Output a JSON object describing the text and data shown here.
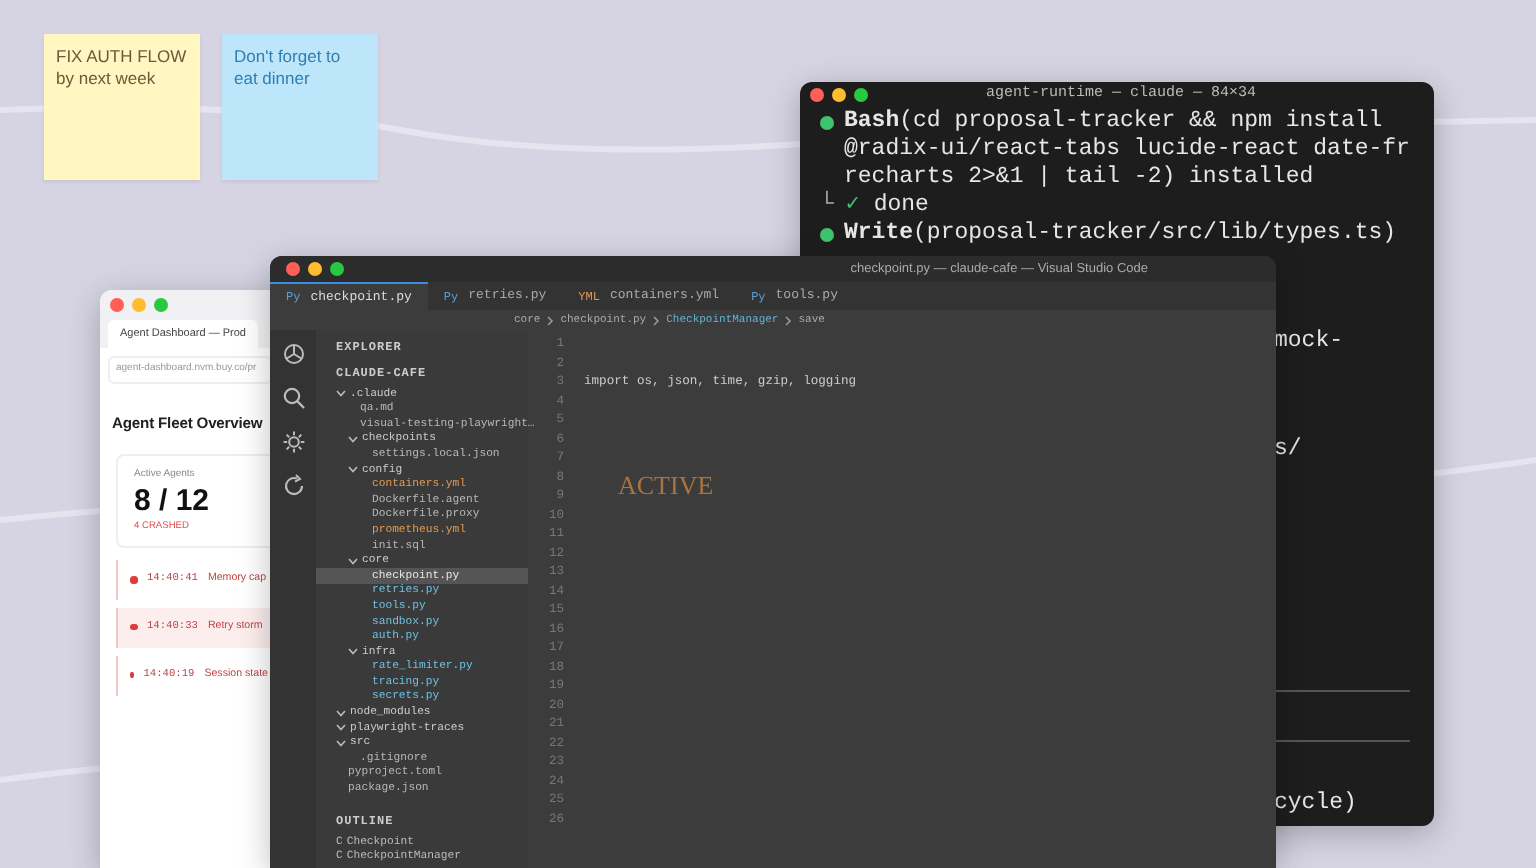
{
  "desktop": {
    "sticky_notes": [
      {
        "text": "FIX AUTH FLOW by next week",
        "color": "#fff6c2"
      },
      {
        "text": "Don't forget to eat dinner",
        "color": "#bde6fb"
      }
    ]
  },
  "browser": {
    "tabs": [
      {
        "label": "Agent Dashboard — Prod",
        "selected": true
      }
    ],
    "url": "agent-dashboard.nvm.buy.co/pr",
    "heading": "Agent Fleet Overview",
    "stat": {
      "label": "Active Agents",
      "value": "8 / 12",
      "note": "4 CRASHED"
    },
    "events": [
      {
        "time": "14:40:41",
        "message": "Memory cap",
        "highlighted": false
      },
      {
        "time": "14:40:33",
        "message": "Retry storm",
        "highlighted": true
      },
      {
        "time": "14:40:19",
        "message": "Session state",
        "highlighted": false
      }
    ]
  },
  "terminal": {
    "title": "agent-runtime — claude — 84×34",
    "lines": [
      {
        "kind": "tool",
        "name": "Bash",
        "args": "(cd proposal-tracker && npm install"
      },
      {
        "kind": "text",
        "text": "@radix-ui/react-tabs lucide-react date-fr"
      },
      {
        "kind": "text",
        "text": "recharts 2>&1 | tail -2) installed"
      },
      {
        "kind": "result",
        "branch": "└",
        "check": "✓",
        "text": "done"
      },
      {
        "kind": "tool",
        "name": "Write",
        "args": "(proposal-tracker/src/lib/types.ts)"
      },
      {
        "kind": "fragment",
        "text": "mock-"
      },
      {
        "kind": "fragment",
        "text": "s/"
      }
    ],
    "footer_fragment": "cycle)"
  },
  "editor": {
    "title": "checkpoint.py — claude-cafe — Visual Studio Code",
    "tabs": [
      {
        "icon": "Py",
        "label": "checkpoint.py",
        "selected": true
      },
      {
        "icon": "Py",
        "label": "retries.py",
        "selected": false
      },
      {
        "icon": "YML",
        "label": "containers.yml",
        "selected": false
      },
      {
        "icon": "Py",
        "label": "tools.py",
        "selected": false
      }
    ],
    "breadcrumb": [
      "core",
      "checkpoint.py",
      "CheckpointManager",
      "save"
    ],
    "sidebar": {
      "title": "EXPLORER",
      "project": "CLAUDE-CAFE",
      "tree": [
        {
          "label": ".claude",
          "expanded": true,
          "selected": false,
          "children": [
            {
              "label": "qa.md",
              "selected": false,
              "color": "#b8b8b8"
            },
            {
              "label": "visual-testing-playwright…",
              "selected": false,
              "color": "#b8b8b8"
            },
            {
              "label": "checkpoints",
              "expanded": true,
              "selected": false,
              "children": [
                {
                  "label": "settings.local.json",
                  "selected": false,
                  "color": "#b8b8b8"
                }
              ]
            },
            {
              "label": "config",
              "expanded": true,
              "selected": false,
              "children": [
                {
                  "label": "containers.yml",
                  "selected": false,
                  "color": "#e39a4f"
                },
                {
                  "label": "Dockerfile.agent",
                  "selected": false,
                  "color": "#b8b8b8"
                },
                {
                  "label": "Dockerfile.proxy",
                  "selected": false,
                  "color": "#b8b8b8"
                },
                {
                  "label": "prometheus.yml",
                  "selected": false,
                  "color": "#e39a4f"
                },
                {
                  "label": "init.sql",
                  "selected": false,
                  "color": "#b8b8b8"
                }
              ]
            },
            {
              "label": "core",
              "expanded": true,
              "selected": false,
              "children": [
                {
                  "label": "checkpoint.py",
                  "selected": true,
                  "color": "#e8e8e8"
                },
                {
                  "label": "retries.py",
                  "selected": false,
                  "color": "#6cc3e0"
                },
                {
                  "label": "tools.py",
                  "selected": false,
                  "color": "#6cc3e0"
                },
                {
                  "label": "sandbox.py",
                  "selected": false,
                  "color": "#6cc3e0"
                },
                {
                  "label": "auth.py",
                  "selected": false,
                  "color": "#6cc3e0"
                }
              ]
            },
            {
              "label": "infra",
              "expanded": true,
              "selected": false,
              "children": [
                {
                  "label": "rate_limiter.py",
                  "selected": false,
                  "color": "#6cc3e0"
                },
                {
                  "label": "tracing.py",
                  "selected": false,
                  "color": "#6cc3e0"
                },
                {
                  "label": "secrets.py",
                  "selected": false,
                  "color": "#6cc3e0"
                }
              ]
            }
          ]
        },
        {
          "label": "node_modules",
          "expanded": true,
          "selected": false
        },
        {
          "label": "playwright-traces",
          "expanded": true,
          "selected": false
        },
        {
          "label": "src",
          "expanded": true,
          "selected": false,
          "children": [
            {
              "label": ".gitignore",
              "selected": false,
              "color": "#b8b8b8"
            }
          ]
        },
        {
          "label": "pyproject.toml",
          "selected": false,
          "color": "#b8b8b8"
        },
        {
          "label": "package.json",
          "selected": false,
          "color": "#b8b8b8"
        }
      ],
      "outline_title": "OUTLINE",
      "outline": [
        {
          "icon": "C",
          "label": "Checkpoint"
        },
        {
          "icon": "C",
          "label": "CheckpointManager"
        }
      ]
    },
    "lines": [
      {
        "number": "1"
      },
      {
        "number": "2"
      },
      {
        "number": "3",
        "code": "import os, json, time, gzip, logging"
      },
      {
        "number": "4"
      },
      {
        "number": "5"
      },
      {
        "number": "6"
      },
      {
        "number": "7"
      },
      {
        "number": "8"
      },
      {
        "number": "9"
      },
      {
        "number": "10"
      },
      {
        "number": "11"
      },
      {
        "number": "12"
      },
      {
        "number": "13"
      },
      {
        "number": "14"
      },
      {
        "number": "15"
      },
      {
        "number": "16"
      },
      {
        "number": "17"
      },
      {
        "number": "18"
      },
      {
        "number": "19"
      },
      {
        "number": "20"
      },
      {
        "number": "21"
      },
      {
        "number": "22"
      },
      {
        "number": "23"
      },
      {
        "number": "24"
      },
      {
        "number": "25"
      },
      {
        "number": "26"
      }
    ],
    "ghost_text": "ACTIVE"
  }
}
